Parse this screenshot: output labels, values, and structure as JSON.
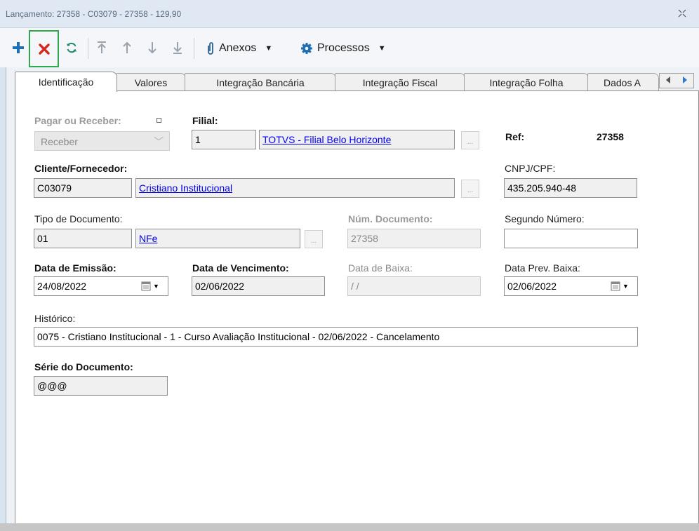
{
  "window": {
    "title": "Lançamento: 27358 - C03079 - 27358 - 129,90"
  },
  "toolbar": {
    "anexos_label": "Anexos",
    "processos_label": "Processos"
  },
  "tabs": [
    {
      "label": "Identificação"
    },
    {
      "label": "Valores"
    },
    {
      "label": "Integração Bancária"
    },
    {
      "label": "Integração Fiscal"
    },
    {
      "label": "Integração Folha"
    },
    {
      "label": "Dados A"
    }
  ],
  "form": {
    "pagar_receber": {
      "label": "Pagar ou Receber:",
      "value": "Receber"
    },
    "filial": {
      "label": "Filial:",
      "code": "1",
      "name": "TOTVS - Filial Belo Horizonte"
    },
    "ref": {
      "label": "Ref:",
      "value": "27358"
    },
    "cliente": {
      "label": "Cliente/Fornecedor:",
      "code": "C03079",
      "name": "Cristiano Institucional"
    },
    "cnpj": {
      "label": "CNPJ/CPF:",
      "value": "435.205.940-48"
    },
    "tipo_doc": {
      "label": "Tipo de Documento:",
      "code": "01",
      "name": "NFe"
    },
    "num_doc": {
      "label": "Núm. Documento:",
      "value": "27358"
    },
    "segundo_num": {
      "label": "Segundo Número:",
      "value": ""
    },
    "data_emissao": {
      "label": "Data de Emissão:",
      "value": "24/08/2022"
    },
    "data_vencimento": {
      "label": "Data de Vencimento:",
      "value": "02/06/2022"
    },
    "data_baixa": {
      "label": "Data de Baixa:",
      "value": " / /"
    },
    "data_prev_baixa": {
      "label": "Data Prev. Baixa:",
      "value": "02/06/2022"
    },
    "historico": {
      "label": "Histórico:",
      "value": "0075 - Cristiano Institucional - 1 - Curso Avaliação Institucional - 02/06/2022 - Cancelamento"
    },
    "serie": {
      "label": "Série do Documento:",
      "value": "@@@"
    }
  },
  "colors": {
    "accent_blue": "#1f6fb5",
    "delete_red": "#d9261c",
    "highlight_green": "#2fa84f",
    "link": "#0000ee"
  }
}
